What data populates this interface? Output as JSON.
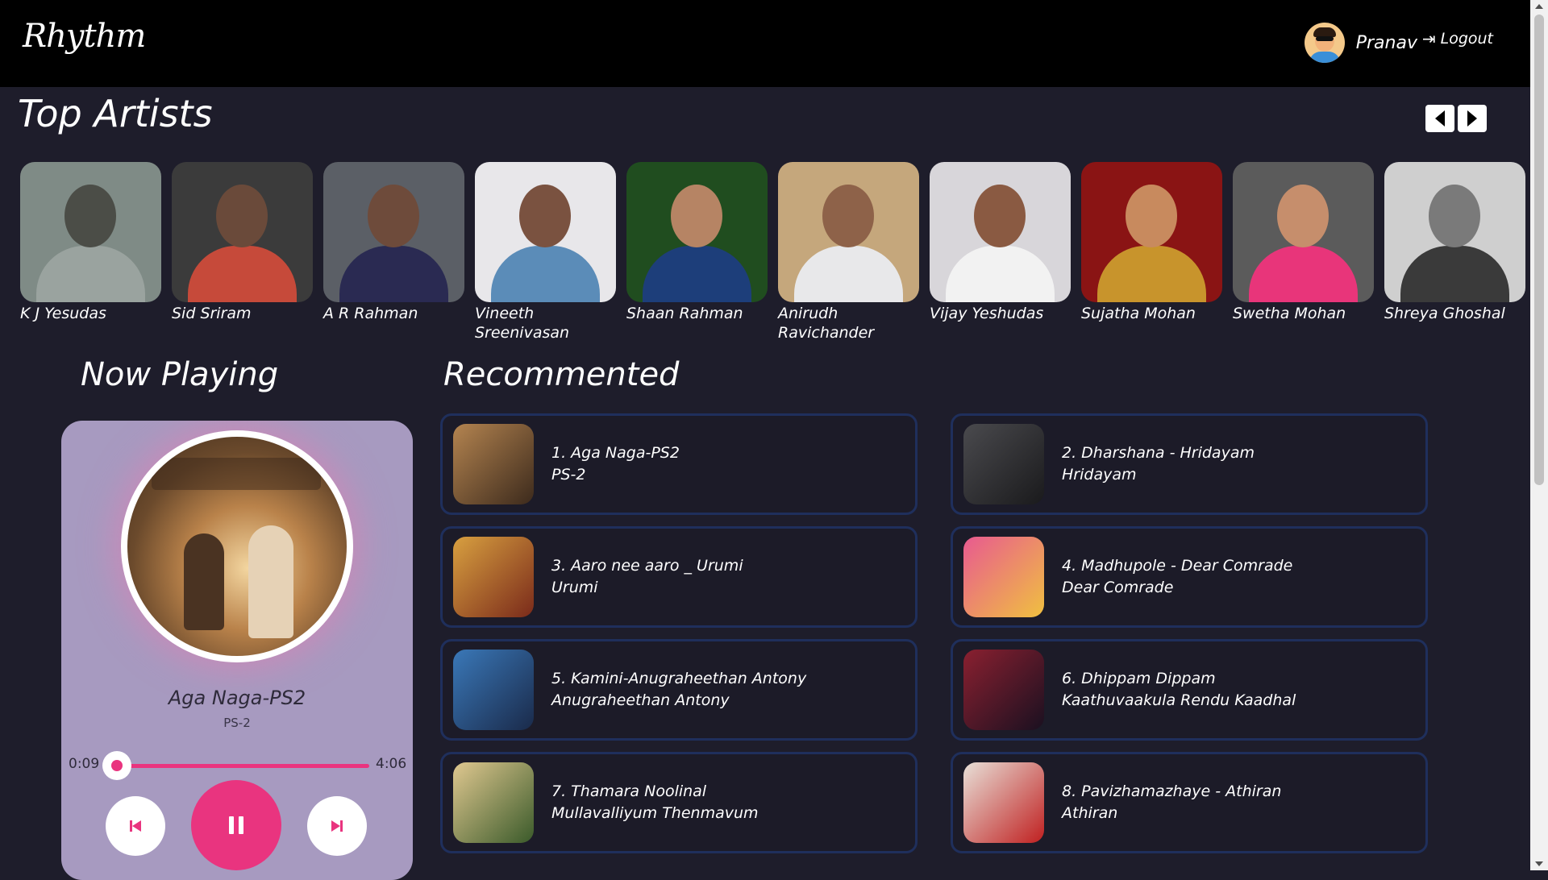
{
  "header": {
    "logo": "Rhythm",
    "user_name": "Pranav",
    "logout_label": "Logout"
  },
  "top_artists": {
    "title": "Top Artists",
    "artists": [
      {
        "name": "K J Yesudas",
        "bg": "#7f8b86",
        "skin": "#4b4d47",
        "cloth": "#9aa39f"
      },
      {
        "name": "Sid Sriram",
        "bg": "#3b3b3b",
        "skin": "#6a4a3a",
        "cloth": "#c64a3a"
      },
      {
        "name": "A R Rahman",
        "bg": "#5b5f66",
        "skin": "#6e4b3b",
        "cloth": "#2a2a52"
      },
      {
        "name": "Vineeth Sreenivasan",
        "bg": "#e8e7ea",
        "skin": "#7a5240",
        "cloth": "#5b8cb8"
      },
      {
        "name": "Shaan Rahman",
        "bg": "#204d1f",
        "skin": "#b68464",
        "cloth": "#1d3e7a"
      },
      {
        "name": "Anirudh Ravichander",
        "bg": "#c5a77c",
        "skin": "#8e6249",
        "cloth": "#e8e8ea"
      },
      {
        "name": "Vijay Yeshudas",
        "bg": "#d8d6da",
        "skin": "#8a5a42",
        "cloth": "#f2f2f2"
      },
      {
        "name": "Sujatha Mohan",
        "bg": "#8a1414",
        "skin": "#c88a5e",
        "cloth": "#c8942c"
      },
      {
        "name": "Swetha Mohan",
        "bg": "#5b5b5b",
        "skin": "#c68e6c",
        "cloth": "#e8357a"
      },
      {
        "name": "Shreya Ghoshal",
        "bg": "#cfcfcf",
        "skin": "#7a7a7a",
        "cloth": "#3a3a3a"
      }
    ]
  },
  "now_playing": {
    "title": "Now Playing",
    "song_title": "Aga Naga-PS2",
    "song_artist": "PS-2",
    "current_time": "0:09",
    "total_time": "4:06",
    "progress": 0.04
  },
  "recommended": {
    "title": "Recommented",
    "items": [
      {
        "line1": "1. Aga Naga-PS2",
        "line2": "PS-2",
        "c1": "#b48450",
        "c2": "#3c2a1c"
      },
      {
        "line1": "2. Dharshana - Hridayam",
        "line2": "Hridayam",
        "c1": "#4a4a4e",
        "c2": "#1a1a1c"
      },
      {
        "line1": "3. Aaro nee aaro _ Urumi",
        "line2": "Urumi",
        "c1": "#d8a040",
        "c2": "#7a2a1a"
      },
      {
        "line1": "4. Madhupole - Dear Comrade",
        "line2": "Dear Comrade",
        "c1": "#e85a90",
        "c2": "#f0c040"
      },
      {
        "line1": "5. Kamini-Anugraheethan Antony",
        "line2": "Anugraheethan Antony",
        "c1": "#3a78b8",
        "c2": "#1a2a4a"
      },
      {
        "line1": "6. Dhippam Dippam",
        "line2": "Kaathuvaakula Rendu Kaadhal",
        "c1": "#8a2030",
        "c2": "#1a1020"
      },
      {
        "line1": "7. Thamara Noolinal",
        "line2": "Mullavalliyum Thenmavum",
        "c1": "#e0c890",
        "c2": "#3a5a2a"
      },
      {
        "line1": "8. Pavizhamazhaye - Athiran",
        "line2": "Athiran",
        "c1": "#e8e0d8",
        "c2": "#c02020"
      }
    ]
  },
  "colors": {
    "accent": "#e9347f",
    "background": "#1e1d2b",
    "card_border": "#1f2f5c",
    "player_bg": "#a79ac0"
  }
}
